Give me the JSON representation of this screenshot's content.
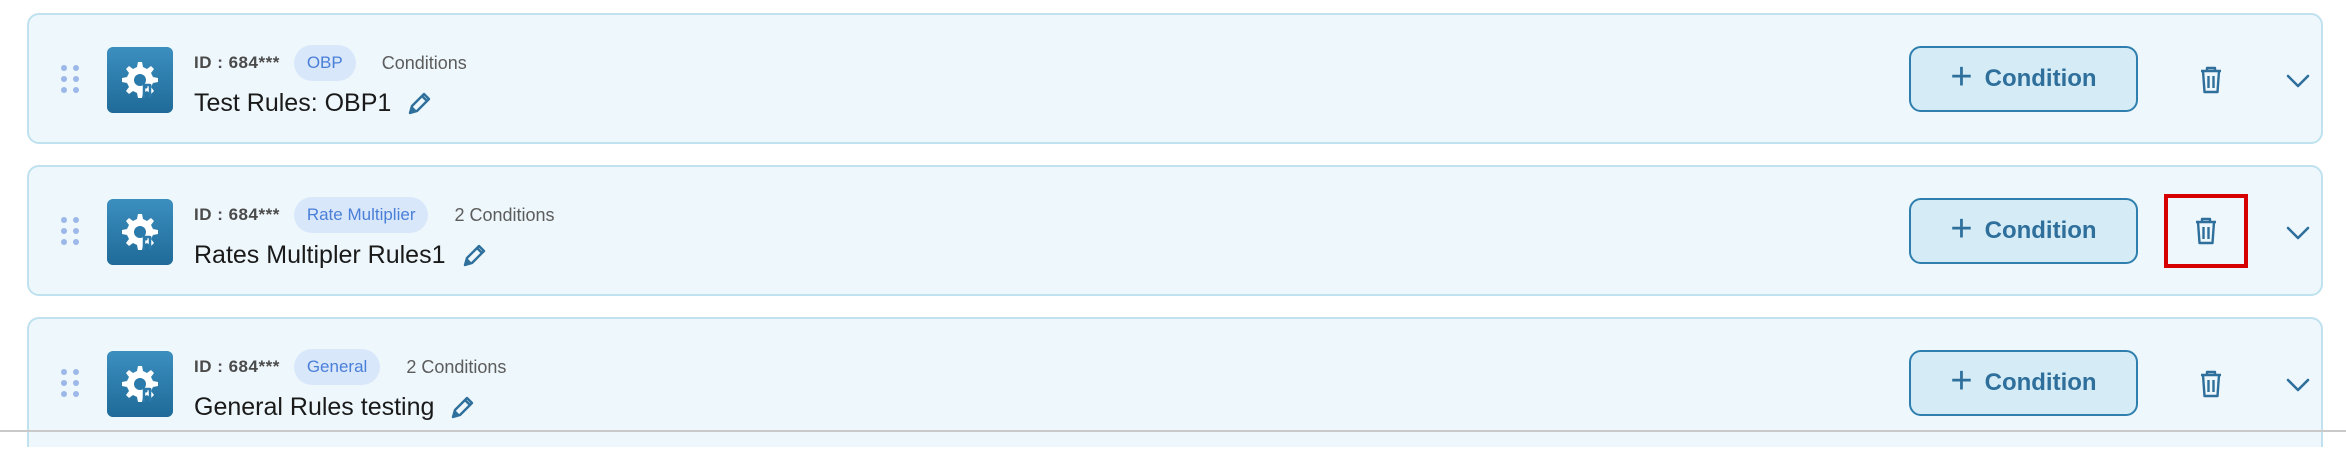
{
  "rules": [
    {
      "id_label": "ID : 684***",
      "type_badge": "OBP",
      "conditions_label": "Conditions",
      "name": "Test Rules: OBP1",
      "add_condition_label": "Condition",
      "delete_highlighted": false
    },
    {
      "id_label": "ID : 684***",
      "type_badge": "Rate Multiplier",
      "conditions_label": "2 Conditions",
      "name": "Rates Multipler Rules1",
      "add_condition_label": "Condition",
      "delete_highlighted": true
    },
    {
      "id_label": "ID : 684***",
      "type_badge": "General",
      "conditions_label": "2 Conditions",
      "name": "General Rules testing",
      "add_condition_label": "Condition",
      "delete_highlighted": false
    }
  ],
  "icons": {
    "drag": "drag-handle-icon",
    "rule": "gear-rule-icon",
    "edit": "pencil-icon",
    "add": "plus-icon",
    "delete": "trash-icon",
    "expand": "chevron-down-icon"
  },
  "colors": {
    "card_bg": "#eef7fb",
    "card_border": "#bfe2ee",
    "accent": "#2f7fae",
    "badge_bg": "#d9e7fb",
    "badge_text": "#4a7fd8",
    "highlight": "#d70000"
  }
}
